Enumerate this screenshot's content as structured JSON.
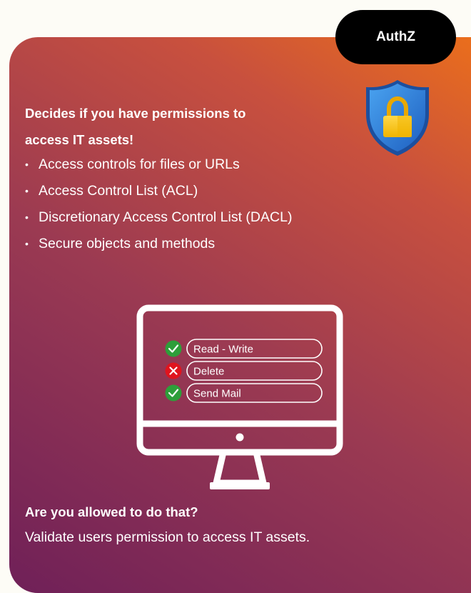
{
  "badge": {
    "label": "AuthZ"
  },
  "heading": {
    "line1": "Decides if you have permissions to",
    "line2": "access IT assets!"
  },
  "bullets": [
    "Access controls for files or URLs",
    "Access Control List (ACL)",
    "Discretionary Access Control List (DACL)",
    "Secure objects and methods"
  ],
  "permissions": [
    {
      "label": "Read - Write",
      "allowed": true
    },
    {
      "label": "Delete",
      "allowed": false
    },
    {
      "label": "Send Mail",
      "allowed": true
    }
  ],
  "question": {
    "title": "Are you allowed to do that?",
    "text": "Validate users permission to access IT assets."
  },
  "icons": [
    "shield-lock-icon",
    "check-icon",
    "cross-icon",
    "monitor-icon"
  ],
  "colors": {
    "background": "#fdfcf6",
    "gradient_top": "#ea6e1c",
    "gradient_bottom": "#6f2058",
    "badge": "#000000",
    "allowed": "#2e9e3a",
    "denied": "#e0141e",
    "shield": "#2a78d8",
    "lock": "#f5c518"
  }
}
